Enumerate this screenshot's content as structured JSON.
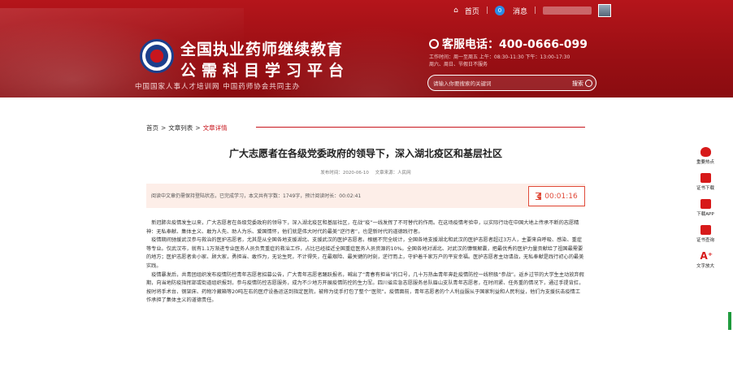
{
  "top_nav": {
    "home": "首页",
    "messages": "消息",
    "message_badge": "0"
  },
  "brand": {
    "title_line1": "全国执业药师继续教育",
    "title_line2": "公需科目学习平台",
    "subtitle": "中国国家人事人才培训网  中国药师协会共同主办"
  },
  "hotline": {
    "label": "客服电话：400-0666-099",
    "hours_line1": "工作时间：周一至周五 上午：08:30-11:30 下午：13:00-17:30",
    "hours_line2": "周六、周日、节假日不服务"
  },
  "search": {
    "placeholder": "请输入你要搜索的关键词",
    "button": "搜索"
  },
  "breadcrumb": {
    "home": "首页",
    "list": "文章列表",
    "current": "文章详情",
    "sep": ">"
  },
  "article": {
    "title": "广大志愿者在各级党委政府的领导下，深入湖北疫区和基层社区",
    "meta_date": "发布时间：2020-06-10",
    "meta_source": "文章来源：人民网",
    "info_bar": "阅读中文章仍需保持登陆状态，已完成学习，本文共有字数：1749字，预计阅读时长：00:02:41",
    "timer": "00:01:16",
    "paragraphs": [
      "新冠肺炎疫情发生以来，广大志愿者在各级党委政府的领导下，深入湖北疫区和基层社区，在战“疫”一线发挥了不可替代的作用。在这场疫情考验中，以实际行动在中国大地上传承不断的志愿精神：无私奉献、集体主义、敢为人先、助人为乐、爱国情怀，他们就是伟大时代的最美“逆行者”，也是新时代的道德践行者。",
      "疫情期间驰援武汉参与救治的医护志愿者，尤其是从全国各地支援湖北、支援武汉的医护志愿者。根据不完全统计，全国各地支援湖北和武汉的医护志愿者超过3万人，主要来自呼吸、感染、重症等专业。仅武汉市，就有1.1万渐进专业医务人员负责重症的救治工作，占比已经接近全国重症医务人员资源的10%。全国各地对湖北、对武汉的慷慨解囊，把最优秀的医护力量贡献给了祖国最需要的地方；医护志愿者舍小家、顾大家，勇担当、敢作为，无论生死，不计得失，在最艰险、最关键的时刻，逆行而上，守护着千家万户的平安幸福。医护志愿者主动请战，无私奉献是践行初心的最美实践。",
      "疫情暴发后，共青团组织发布疫情防控青年志愿者招募公告，广大青年志愿者踊跃报名，喊出了“青春有担当”的口号，几十万热血青年奔赴疫情防控一线积极“参战”。返乡过节的大学生主动放弃假期，向当地防疫指挥部或街道组织报到，参与疫情防控志愿服务，成为不少地方开展疫情防控的生力军。四川省应急志愿服务总队眉山支队青年志愿者，在时间紧、任务重的情况下，通过手提背扛，按时将手术台、钢架床、药物冷藏箱等20吨左右的医疗设备运送到指定医院，被称为徒手打包了整个“医院”。疫情面前，青年志愿者的个人利益服从于国家利益和人民利益，他们为支援抗击疫情工作承担了集体主义的道德责任。"
    ]
  },
  "right_toolbar": [
    {
      "icon": "hot-topic-icon",
      "label": "重要热点"
    },
    {
      "icon": "certificate-icon",
      "label": "证书下载"
    },
    {
      "icon": "app-download-icon",
      "label": "下载APP"
    },
    {
      "icon": "cert-query-icon",
      "label": "证书查询"
    },
    {
      "icon": "font-size-icon",
      "label": "文字放大"
    }
  ],
  "colors": {
    "brand_red": "#b5151b",
    "accent_red": "#c8161d",
    "timer_red": "#e04b3a",
    "info_bg": "#fdeee8"
  }
}
